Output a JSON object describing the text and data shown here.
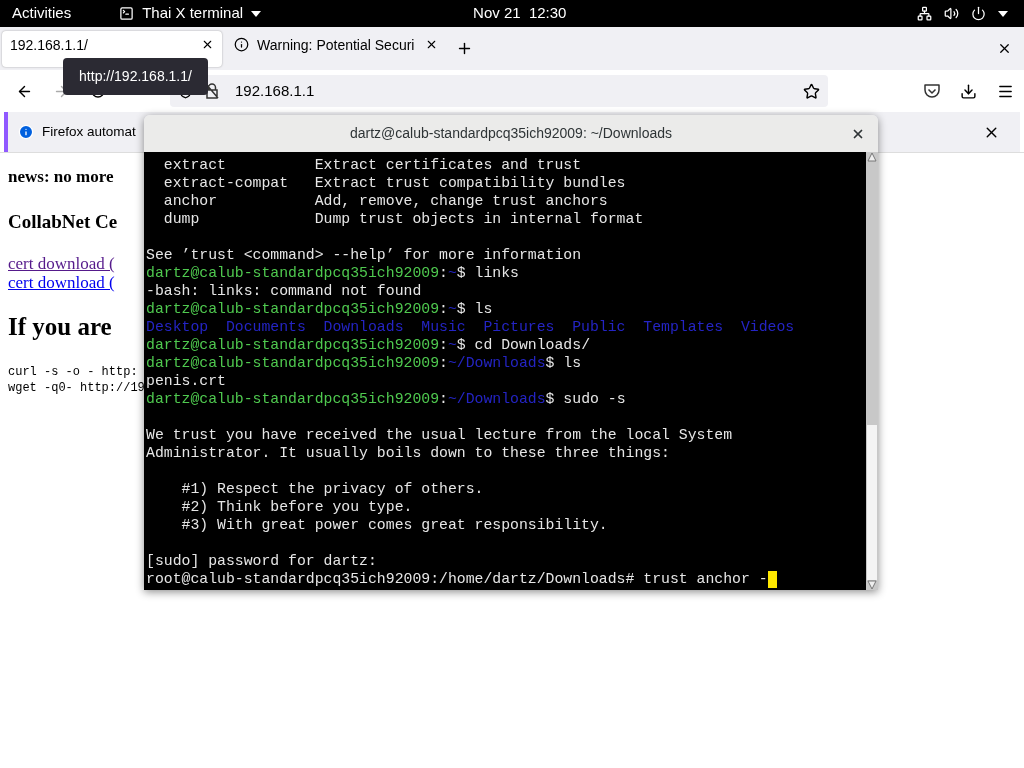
{
  "topbar": {
    "activities": "Activities",
    "app_menu": "Thai X terminal",
    "clock": "Nov 21  12:30"
  },
  "browser": {
    "tabs": [
      {
        "title": "192.168.1.1/",
        "selected": true,
        "kind": "page"
      },
      {
        "title": "Warning: Potential Securi",
        "selected": false,
        "kind": "info"
      }
    ],
    "tooltip": "http://192.168.1.1/",
    "url": "192.168.1.1",
    "notification": "Firefox automat",
    "page": [
      {
        "kind": "bold",
        "text": "news: no more"
      },
      {
        "kind": "heading",
        "text": "CollabNet Ce"
      },
      {
        "kind": "link",
        "text": "cert download (",
        "visited": true
      },
      {
        "kind": "link",
        "text": "cert download (",
        "visited": false
      },
      {
        "kind": "title",
        "text": "If you are"
      },
      {
        "kind": "code",
        "text": "curl -s -o - http:"
      },
      {
        "kind": "code",
        "text": "wget -q0- http://19"
      }
    ]
  },
  "terminal": {
    "title": "dartz@calub-standardpcq35ich92009: ~/Downloads",
    "lines": [
      {
        "segments": [
          {
            "kind": "text",
            "text": "  extract          Extract certificates and trust"
          }
        ]
      },
      {
        "segments": [
          {
            "kind": "text",
            "text": "  extract-compat   Extract trust compatibility bundles"
          }
        ]
      },
      {
        "segments": [
          {
            "kind": "text",
            "text": "  anchor           Add, remove, change trust anchors"
          }
        ]
      },
      {
        "segments": [
          {
            "kind": "text",
            "text": "  dump             Dump trust objects in internal format"
          }
        ]
      },
      {
        "kind": "blank"
      },
      {
        "segments": [
          {
            "kind": "text",
            "text": "See ’trust <command> --help’ for more information"
          }
        ]
      },
      {
        "segments": [
          {
            "kind": "user",
            "text": "dartz@calub-standardpcq35ich92009"
          },
          {
            "kind": "text",
            "text": ":"
          },
          {
            "kind": "path",
            "text": "~"
          },
          {
            "kind": "text",
            "text": "$ links"
          }
        ]
      },
      {
        "segments": [
          {
            "kind": "text",
            "text": "-bash: links: command not found"
          }
        ]
      },
      {
        "segments": [
          {
            "kind": "user",
            "text": "dartz@calub-standardpcq35ich92009"
          },
          {
            "kind": "text",
            "text": ":"
          },
          {
            "kind": "path",
            "text": "~"
          },
          {
            "kind": "text",
            "text": "$ ls"
          }
        ]
      },
      {
        "segments": [
          {
            "kind": "path",
            "text": "Desktop  Documents  Downloads  Music  Pictures  Public  Templates  Videos"
          }
        ]
      },
      {
        "segments": [
          {
            "kind": "user",
            "text": "dartz@calub-standardpcq35ich92009"
          },
          {
            "kind": "text",
            "text": ":"
          },
          {
            "kind": "path",
            "text": "~"
          },
          {
            "kind": "text",
            "text": "$ cd Downloads/"
          }
        ]
      },
      {
        "segments": [
          {
            "kind": "user",
            "text": "dartz@calub-standardpcq35ich92009"
          },
          {
            "kind": "text",
            "text": ":"
          },
          {
            "kind": "path",
            "text": "~/Downloads"
          },
          {
            "kind": "text",
            "text": "$ ls"
          }
        ]
      },
      {
        "segments": [
          {
            "kind": "text",
            "text": "penis.crt"
          }
        ]
      },
      {
        "segments": [
          {
            "kind": "user",
            "text": "dartz@calub-standardpcq35ich92009"
          },
          {
            "kind": "text",
            "text": ":"
          },
          {
            "kind": "path",
            "text": "~/Downloads"
          },
          {
            "kind": "text",
            "text": "$ sudo -s"
          }
        ]
      },
      {
        "kind": "blank"
      },
      {
        "segments": [
          {
            "kind": "text",
            "text": "We trust you have received the usual lecture from the local System"
          }
        ]
      },
      {
        "segments": [
          {
            "kind": "text",
            "text": "Administrator. It usually boils down to these three things:"
          }
        ]
      },
      {
        "kind": "blank"
      },
      {
        "segments": [
          {
            "kind": "text",
            "text": "    #1) Respect the privacy of others."
          }
        ]
      },
      {
        "segments": [
          {
            "kind": "text",
            "text": "    #2) Think before you type."
          }
        ]
      },
      {
        "segments": [
          {
            "kind": "text",
            "text": "    #3) With great power comes great responsibility."
          }
        ]
      },
      {
        "kind": "blank"
      },
      {
        "segments": [
          {
            "kind": "text",
            "text": "[sudo] password for dartz:"
          }
        ]
      },
      {
        "segments": [
          {
            "kind": "text",
            "text": "root@calub-standardpcq35ich92009:/home/dartz/Downloads# trust anchor -"
          }
        ],
        "cursor": true
      }
    ]
  }
}
